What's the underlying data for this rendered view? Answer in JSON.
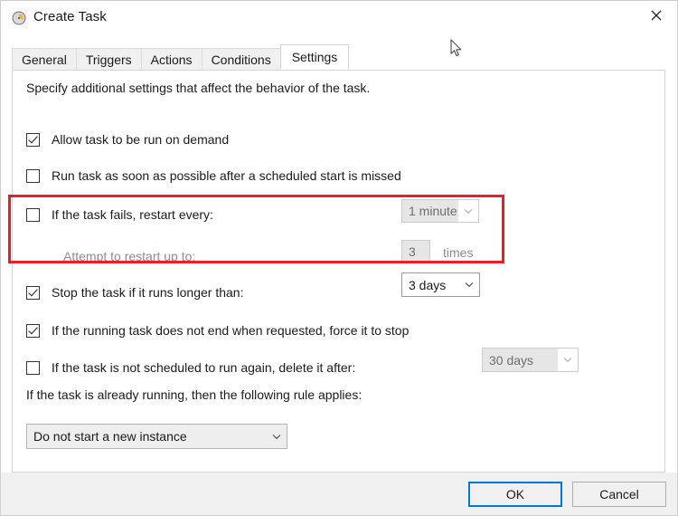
{
  "window": {
    "title": "Create Task",
    "icon": "clock-icon",
    "close_label": "✕"
  },
  "tabs": [
    {
      "label": "General",
      "active": false
    },
    {
      "label": "Triggers",
      "active": false
    },
    {
      "label": "Actions",
      "active": false
    },
    {
      "label": "Conditions",
      "active": false
    },
    {
      "label": "Settings",
      "active": true
    }
  ],
  "settings": {
    "description": "Specify additional settings that affect the behavior of the task.",
    "allow_on_demand": {
      "label": "Allow task to be run on demand",
      "checked": true
    },
    "run_asap_missed": {
      "label": "Run task as soon as possible after a scheduled start is missed",
      "checked": false
    },
    "restart_on_fail": {
      "label": "If the task fails, restart every:",
      "checked": false,
      "interval_value": "1 minute",
      "enabled": false
    },
    "restart_attempts": {
      "label": "Attempt to restart up to:",
      "count_value": "3",
      "unit_label": "times",
      "enabled": false
    },
    "stop_if_longer": {
      "label": "Stop the task if it runs longer than:",
      "checked": true,
      "duration_value": "3 days",
      "enabled": true
    },
    "force_stop": {
      "label": "If the running task does not end when requested, force it to stop",
      "checked": true
    },
    "delete_after": {
      "label": "If the task is not scheduled to run again, delete it after:",
      "checked": false,
      "duration_value": "30 days",
      "enabled": false
    },
    "already_running": {
      "label": "If the task is already running, then the following rule applies:",
      "rule_value": "Do not start a new instance"
    }
  },
  "footer": {
    "ok_label": "OK",
    "cancel_label": "Cancel"
  },
  "annotation": {
    "highlight_color": "#ee1c25"
  }
}
